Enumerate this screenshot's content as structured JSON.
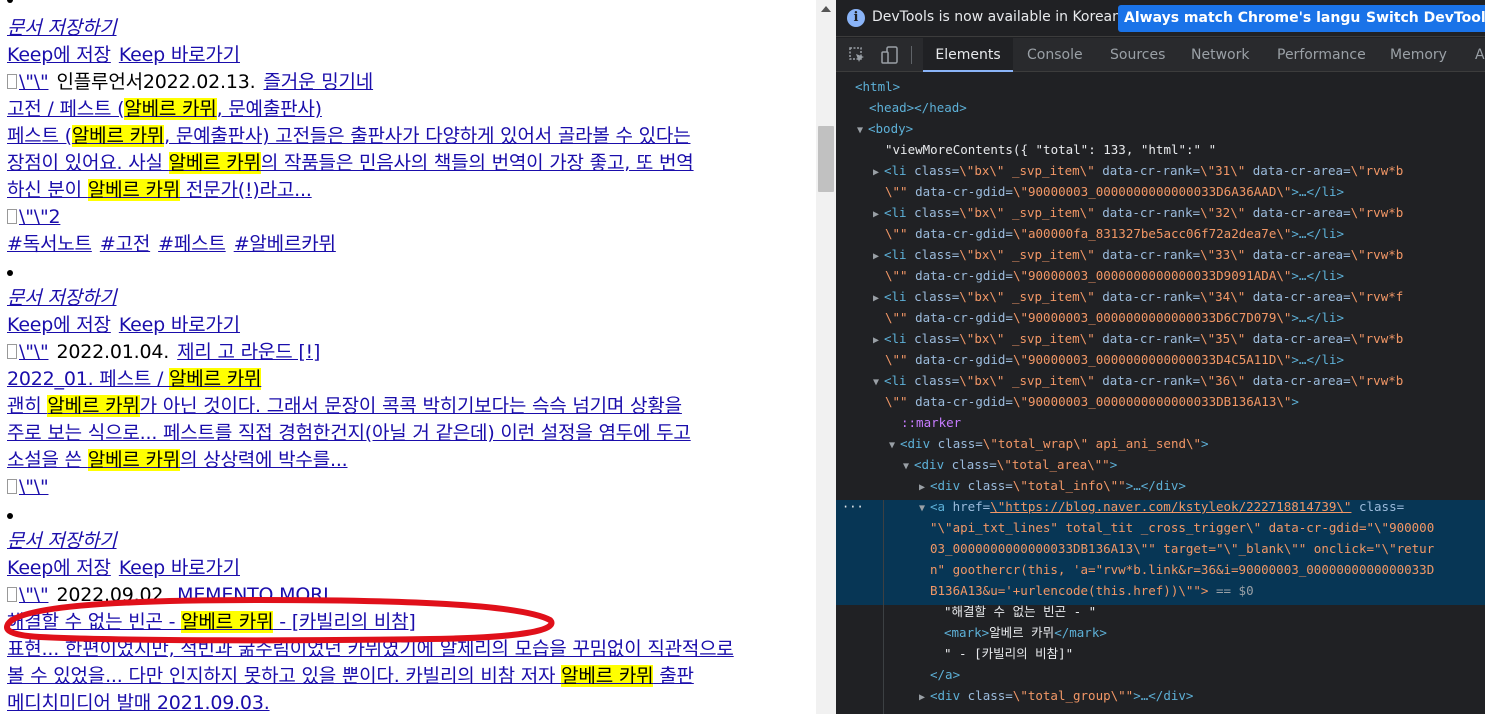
{
  "page": {
    "groups": [
      {
        "save_doc": "문서 저장하기",
        "keep_save": "Keep에 저장",
        "keep_goto": "Keep 바로가기",
        "img_alt": "\\\"\\\"",
        "author": "인플루언서",
        "date": "2022.02.13.",
        "blog": "즐거운 밍기네",
        "title_a": "고전 / 페스트 (",
        "title_mark": "알베르 카뮈",
        "title_b": ", 문예출판사)",
        "desc": [
          [
            "페스트 (",
            "알베르 카뮈",
            ", 문예출판사) 고전들은 출판사가 다양하게 있어서 골라볼 수 있다는"
          ],
          [
            "장점이 있어요. 사실 ",
            "알베르 카뮈",
            "의 작품들은 민음사의 책들의 번역이 가장 좋고, 또 번역"
          ],
          [
            "하신 분이 ",
            "알베르 카뮈",
            " 전문가(!)라고..."
          ]
        ],
        "thumb_alt": "\\\"\\\"2",
        "tags": [
          "#독서노트",
          "#고전",
          "#페스트",
          "#알베르카뮈"
        ]
      },
      {
        "save_doc": "문서 저장하기",
        "keep_save": "Keep에 저장",
        "keep_goto": "Keep 바로가기",
        "img_alt": "\\\"\\\"",
        "date": "2022.01.04.",
        "blog": "제리 고 라운드 [!]",
        "title_a": "2022_01. 페스트 / ",
        "title_mark": "알베르 카뮈",
        "desc": [
          [
            "괜히 ",
            "알베르 카뮈",
            "가 아닌 것이다. 그래서 문장이 콕콕 박히기보다는 슥슥 넘기며 상황을"
          ],
          [
            "주로 보는 식으로... 페스트를 직접 경험한건지(아닐 거 같은데) 이런 설정을 염두에 두고"
          ],
          [
            "소설을 쓴 ",
            "알베르 카뮈",
            "의 상상력에 박수를..."
          ]
        ],
        "thumb_alt": "\\\"\\\""
      },
      {
        "save_doc": "문서 저장하기",
        "keep_save": "Keep에 저장",
        "keep_goto": "Keep 바로가기",
        "img_alt": "\\\"\\\"",
        "date": "2022.09.02.",
        "blog": "MEMENTO MORI",
        "title_a": "해결할 수 없는 빈곤 - ",
        "title_mark": "알베르 카뮈",
        "title_b": " - [카빌리의 비참]",
        "desc": [
          [
            "표현... 한편이었지만, 적빈과 굶주림이었던 카뮈였기에 알제리의 모습을 꾸밈없이 직관적으로"
          ],
          [
            "볼 수 있었을... 다만 인지하지 못하고 있을 뿐이다. 카빌리의 비참 저자 ",
            "알베르 카뮈",
            " 출판"
          ],
          [
            "메디치미디어 발매 2021.09.03."
          ]
        ]
      }
    ]
  },
  "devtools": {
    "infobar": {
      "message": "DevTools is now available in Korean!",
      "match_button": "Always match Chrome's language",
      "switch_button": "Switch DevTools t"
    },
    "tabs": [
      "Elements",
      "Console",
      "Sources",
      "Network",
      "Performance",
      "Memory",
      "A"
    ],
    "active_tab": "Elements",
    "dom": {
      "html": "<html>",
      "head": "<head></head>",
      "body": "<body>",
      "text_node": "\"viewMoreContents({ \"total\": 133, \"html\":\" \"",
      "li_items": [
        {
          "rank": "\\\"31\\\"",
          "area": "\\\"rvw*b",
          "gdid": "\\\"90000003_0000000000000033D6A36AAD\\\""
        },
        {
          "rank": "\\\"32\\\"",
          "area": "\\\"rvw*b",
          "gdid": "\\\"a00000fa_831327be5acc06f72a2dea7e\\\""
        },
        {
          "rank": "\\\"33\\\"",
          "area": "\\\"rvw*b",
          "gdid": "\\\"90000003_0000000000000033D9091ADA\\\""
        },
        {
          "rank": "\\\"34\\\"",
          "area": "\\\"rvw*f",
          "gdid": "\\\"90000003_0000000000000033D6C7D079\\\""
        },
        {
          "rank": "\\\"35\\\"",
          "area": "\\\"rvw*b",
          "gdid": "\\\"90000003_0000000000000033D4C5A11D\\\""
        },
        {
          "rank": "\\\"36\\\"",
          "area": "\\\"rvw*b",
          "gdid": "\\\"90000003_0000000000000033DB136A13\\\""
        }
      ],
      "li_class": "\\\"bx\\\" _svp_item\\\"",
      "marker": "::marker",
      "total_wrap": "\\\"total_wrap\\\" api_ani_send\\\"",
      "total_area": "\\\"total_area\\\"\"",
      "total_info": "\\\"total_info\\\"\"",
      "a_href": "\\\"https://blog.naver.com/kstyleok/222718814739\\\"",
      "a_class": "class=",
      "a_line2": "\"\\\"api_txt_lines\" total_tit _cross_trigger\\\" data-cr-gdid=\"\\\"900000",
      "a_line3": "03_0000000000000033DB136A13\\\"\" target=\"\\\"_blank\\\"\" onclick=\"\\\"retur",
      "a_line4": "n\" goothercr(this, 'a=\"rvw*b.link&r=36&i=90000003_0000000000000033D",
      "a_line5": "B136A13&u='+urlencode(this.href))\\\"\">",
      "eq0": "== $0",
      "text1": "\"해결할 수 없는 빈곤 - \"",
      "mark_text": "알베르 카뮈",
      "text2": "\" - [카빌리의 비참]\"",
      "a_close": "</a>",
      "total_group": "\\\"total_group\\\"\""
    }
  }
}
